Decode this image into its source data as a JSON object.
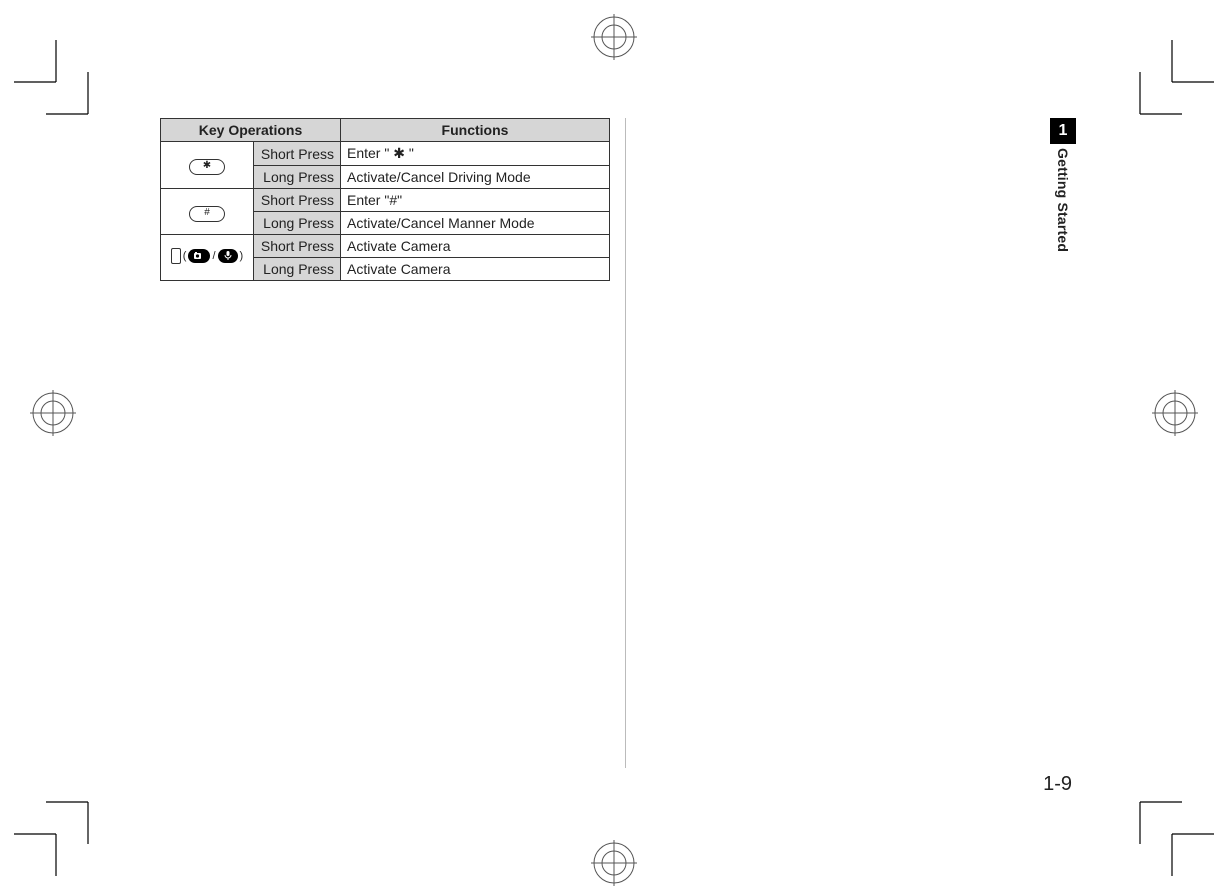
{
  "table": {
    "headers": {
      "key_ops": "Key Operations",
      "functions": "Functions"
    },
    "rows": [
      {
        "key_symbol": "✱",
        "key_type": "oval",
        "short_label": "Short Press",
        "short_fn": "Enter \" ✱ \"",
        "long_label": "Long Press",
        "long_fn": "Activate/Cancel Driving Mode"
      },
      {
        "key_symbol": "#",
        "key_type": "oval",
        "short_label": "Short Press",
        "short_fn": "Enter \"#\"",
        "long_label": "Long Press",
        "long_fn": "Activate/Cancel Manner Mode"
      },
      {
        "key_symbol": "camera-mic-side-key",
        "key_type": "side",
        "short_label": "Short Press",
        "short_fn": "Activate Camera",
        "long_label": "Long Press",
        "long_fn": "Activate Camera"
      }
    ]
  },
  "side_tab": {
    "number": "1",
    "title": "Getting Started"
  },
  "page_number": "1-9"
}
